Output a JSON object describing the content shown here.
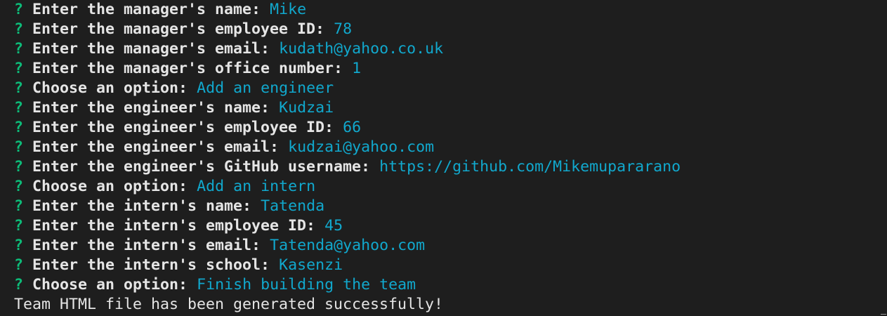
{
  "terminal": {
    "prompt_symbol": "?",
    "lines": [
      {
        "prompt": "Enter the manager's name:",
        "answer": "Mike"
      },
      {
        "prompt": "Enter the manager's employee ID:",
        "answer": "78"
      },
      {
        "prompt": "Enter the manager's email:",
        "answer": "kudath@yahoo.co.uk"
      },
      {
        "prompt": "Enter the manager's office number:",
        "answer": "1"
      },
      {
        "prompt": "Choose an option:",
        "answer": "Add an engineer"
      },
      {
        "prompt": "Enter the engineer's name:",
        "answer": "Kudzai"
      },
      {
        "prompt": "Enter the engineer's employee ID:",
        "answer": "66"
      },
      {
        "prompt": "Enter the engineer's email:",
        "answer": "kudzai@yahoo.com"
      },
      {
        "prompt": "Enter the engineer's GitHub username:",
        "answer": "https://github.com/Mikemupararano"
      },
      {
        "prompt": "Choose an option:",
        "answer": "Add an intern"
      },
      {
        "prompt": "Enter the intern's name:",
        "answer": "Tatenda"
      },
      {
        "prompt": "Enter the intern's employee ID:",
        "answer": "45"
      },
      {
        "prompt": "Enter the intern's email:",
        "answer": "Tatenda@yahoo.com"
      },
      {
        "prompt": "Enter the intern's school:",
        "answer": "Kasenzi"
      },
      {
        "prompt": "Choose an option:",
        "answer": "Finish building the team"
      }
    ],
    "final_output": "Team HTML file has been generated successfully!"
  },
  "colors": {
    "background": "#1e1e1e",
    "prompt_symbol": "#0dbc79",
    "prompt_text": "#e5e5e5",
    "answer_text": "#11a8cd"
  }
}
